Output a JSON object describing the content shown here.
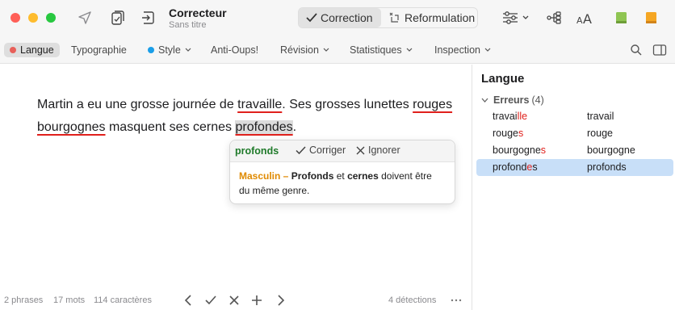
{
  "window": {
    "app_title": "Correcteur",
    "doc_title": "Sans titre",
    "icons": [
      "send-icon",
      "check-document-icon",
      "insert-icon",
      "settings-sliders-icon",
      "tree-icon",
      "text-size-icon",
      "green-book-icon",
      "orange-book-icon"
    ],
    "mode_segment": {
      "correction_label": "Correction",
      "reformulation_label": "Reformulation"
    }
  },
  "tabs": [
    {
      "label": "Langue",
      "dot": "#e8605a",
      "selected": true
    },
    {
      "label": "Typographie"
    },
    {
      "label": "Style",
      "dot": "#1a9ee8",
      "chevron": true
    },
    {
      "label": "Anti-Oups!"
    },
    {
      "label": "Révision",
      "chevron": true
    },
    {
      "label": "Statistiques",
      "chevron": true
    },
    {
      "label": "Inspection",
      "chevron": true
    }
  ],
  "editor": {
    "sentence": {
      "p1": "Martin a eu une grosse journée de ",
      "e1": "travaille",
      "p2": ". Ses grosses lunettes ",
      "e2": "rouges",
      "sp": " ",
      "e3": "bourgognes",
      "p3": " masquent ses cernes ",
      "e4": "profondes",
      "p4": "."
    }
  },
  "popup": {
    "word": "profonds",
    "fix_label": "Corriger",
    "ignore_label": "Ignorer",
    "category": "Masculin –",
    "t1": "Profonds",
    "t2": " et ",
    "t3": "cernes",
    "t4": " doivent être",
    "t5": "du même genre."
  },
  "status": {
    "phrases": "2 phrases",
    "mots": "17 mots",
    "caracteres": "114 caractères",
    "detections": "4 détections"
  },
  "sidebar": {
    "title": "Langue",
    "group_label": "Erreurs",
    "group_count": "(4)",
    "errors": [
      {
        "a": "travai",
        "b": "lle",
        "suggestion": "travail"
      },
      {
        "a": "rouge",
        "b": "s",
        "suggestion": "rouge"
      },
      {
        "a": "bourgogne",
        "b": "s",
        "suggestion": "bourgogne"
      },
      {
        "a": "profond",
        "b": "e",
        "c": "s",
        "suggestion": "profonds",
        "selected": true
      }
    ]
  },
  "colors": {
    "error_underline": "#e0201c",
    "category_orange": "#e08a00",
    "word_green": "#1f7a2a",
    "selection_blue": "#c8dff8"
  }
}
